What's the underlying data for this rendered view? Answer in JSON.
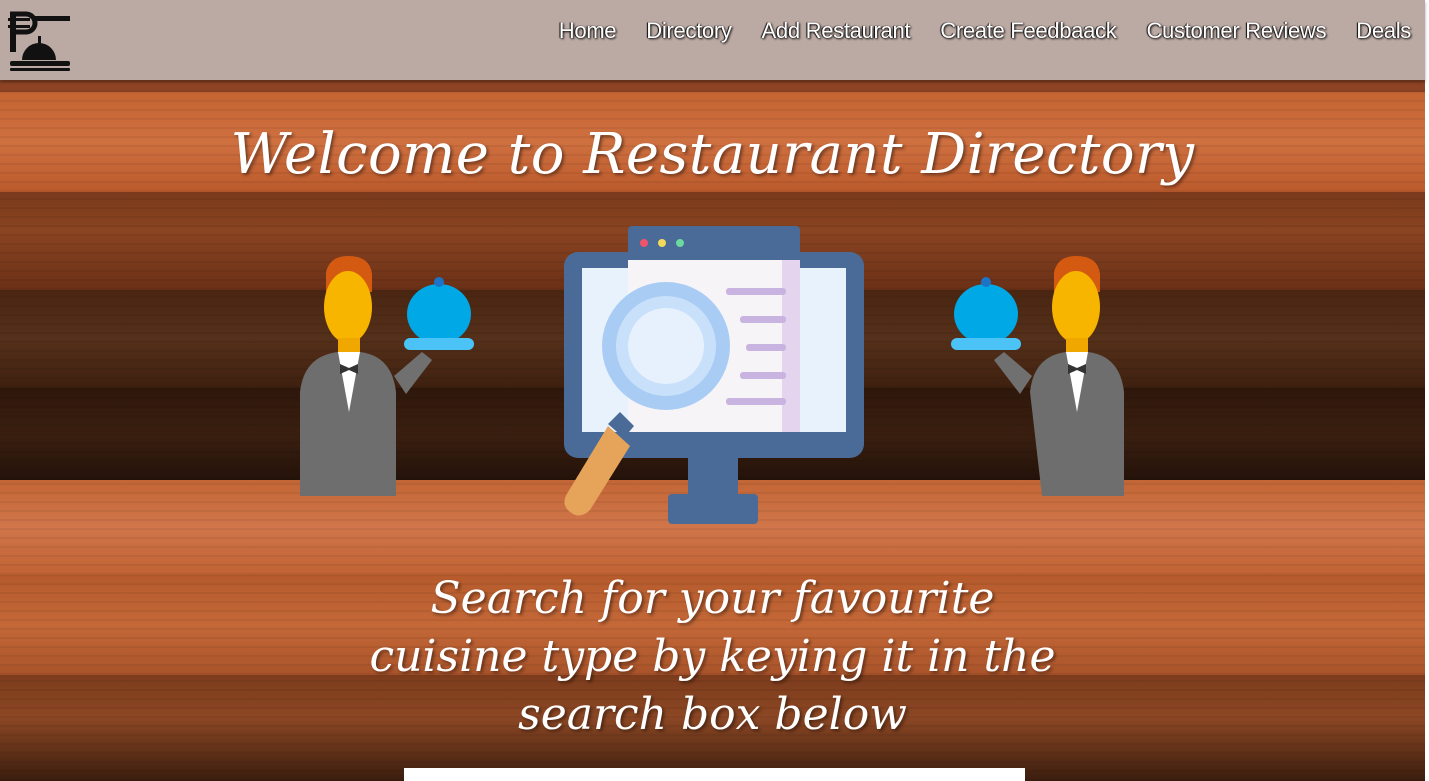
{
  "brand": {
    "logo_icon": "chef-cloche-icon"
  },
  "nav": {
    "items": [
      {
        "label": "Home"
      },
      {
        "label": "Directory"
      },
      {
        "label": "Add Restaurant"
      },
      {
        "label": "Create Feedbaack"
      },
      {
        "label": "Customer Reviews"
      },
      {
        "label": "Deals"
      }
    ]
  },
  "hero": {
    "title": "Welcome to Restaurant Directory",
    "subtitle_lines": [
      "Search for your favourite",
      "cuisine type by keying it in the",
      "search box below"
    ],
    "illustration_icons": [
      "waiter-icon",
      "monitor-search-icon",
      "waiter-icon"
    ]
  },
  "search": {
    "placeholder": ""
  },
  "colors": {
    "navbar": "#bba9a3",
    "wood_light": "#c8693a",
    "wood_dark": "#3a2012",
    "text": "#ffffff"
  }
}
